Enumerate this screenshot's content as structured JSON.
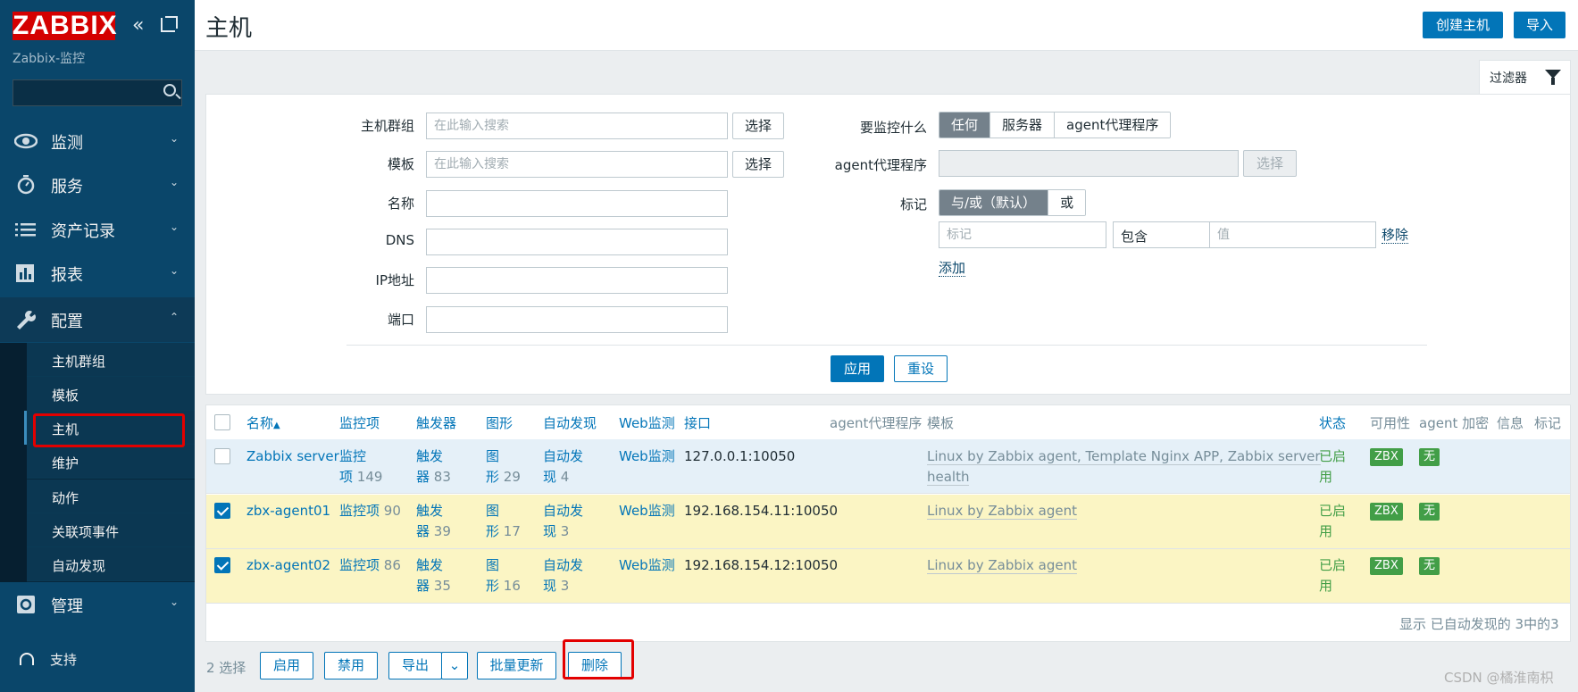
{
  "sidebar": {
    "logo": "ZABBIX",
    "server_name": "Zabbix-监控",
    "menu": [
      {
        "label": "监测",
        "icon": "eye-icon"
      },
      {
        "label": "服务",
        "icon": "stopwatch-icon"
      },
      {
        "label": "资产记录",
        "icon": "list-icon"
      },
      {
        "label": "报表",
        "icon": "bar-chart-icon"
      },
      {
        "label": "配置",
        "icon": "wrench-icon"
      },
      {
        "label": "管理",
        "icon": "gear-icon"
      }
    ],
    "submenu": [
      "主机群组",
      "模板",
      "主机",
      "维护",
      "动作",
      "关联项事件",
      "自动发现"
    ],
    "support": "支持"
  },
  "header": {
    "title": "主机",
    "create_button": "创建主机",
    "import_button": "导入"
  },
  "filter": {
    "tab_label": "过滤器",
    "host_groups_label": "主机群组",
    "templates_label": "模板",
    "name_label": "名称",
    "dns_label": "DNS",
    "ip_label": "IP地址",
    "port_label": "端口",
    "search_placeholder": "在此输入搜索",
    "select_button": "选择",
    "monitored_by_label": "要监控什么",
    "monitored_by_options": [
      "任何",
      "服务器",
      "agent代理程序"
    ],
    "proxy_label": "agent代理程序",
    "tags_label": "标记",
    "tag_operator_options": [
      "与/或（默认）",
      "或"
    ],
    "tag_placeholder": "标记",
    "tag_condition": "包含",
    "value_placeholder": "值",
    "remove_link": "移除",
    "add_link": "添加",
    "apply_button": "应用",
    "reset_button": "重设"
  },
  "table": {
    "columns": [
      "名称",
      "监控项",
      "触发器",
      "图形",
      "自动发现",
      "Web监测",
      "接口",
      "agent代理程序",
      "模板",
      "状态",
      "可用性",
      "agent 加密",
      "信息",
      "标记"
    ],
    "sort_indicator": "▲",
    "rows": [
      {
        "checked": false,
        "name": "Zabbix server",
        "items_label_1": "监控",
        "items_label_2": "项",
        "items_count": "149",
        "triggers_label_1": "触发",
        "triggers_label_2": "器",
        "triggers_count": "83",
        "graphs_label_1": "图",
        "graphs_label_2": "形",
        "graphs_count": "29",
        "discovery_label_1": "自动发",
        "discovery_label_2": "现",
        "discovery_count": "4",
        "web": "Web监测",
        "interface": "127.0.0.1:10050",
        "templates_line1": "Linux by Zabbix agent, Template Nginx APP, Zabbix server",
        "templates_line2": "health",
        "status_1": "已启",
        "status_2": "用",
        "availability": "ZBX",
        "encryption": "无"
      },
      {
        "checked": true,
        "name": "zbx-agent01",
        "items_label_1": "监控项",
        "items_count": "90",
        "triggers_label_1": "触发",
        "triggers_label_2": "器",
        "triggers_count": "39",
        "graphs_label_1": "图",
        "graphs_label_2": "形",
        "graphs_count": "17",
        "discovery_label_1": "自动发",
        "discovery_label_2": "现",
        "discovery_count": "3",
        "web": "Web监测",
        "interface": "192.168.154.11:10050",
        "templates_line1": "Linux by Zabbix agent",
        "status_1": "已启",
        "status_2": "用",
        "availability": "ZBX",
        "encryption": "无"
      },
      {
        "checked": true,
        "name": "zbx-agent02",
        "items_label_1": "监控项",
        "items_count": "86",
        "triggers_label_1": "触发",
        "triggers_label_2": "器",
        "triggers_count": "35",
        "graphs_label_1": "图",
        "graphs_label_2": "形",
        "graphs_count": "16",
        "discovery_label_1": "自动发",
        "discovery_label_2": "现",
        "discovery_count": "3",
        "web": "Web监测",
        "interface": "192.168.154.12:10050",
        "templates_line1": "Linux by Zabbix agent",
        "status_1": "已启",
        "status_2": "用",
        "availability": "ZBX",
        "encryption": "无"
      }
    ],
    "footer": "显示 已自动发现的 3中的3"
  },
  "actions": {
    "selected_count": "2 选择",
    "enable": "启用",
    "disable": "禁用",
    "export": "导出",
    "mass_update": "批量更新",
    "delete": "删除"
  },
  "watermark": "CSDN @橘淮南枳",
  "colors": {
    "sidebar": "#0a466a",
    "accent": "#0275b8",
    "logo": "#d40000",
    "enabled": "#429e47",
    "highlight": "#e30000"
  }
}
